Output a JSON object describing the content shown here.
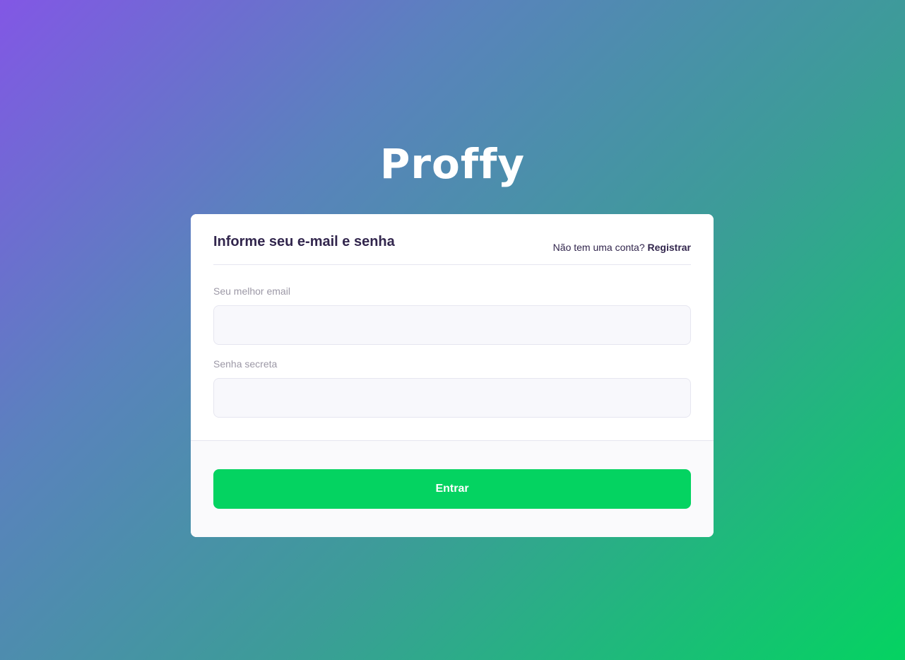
{
  "brand": {
    "logo_text": "Proffy"
  },
  "login_card": {
    "title": "Informe seu e-mail e senha",
    "signup_prompt": "Não tem uma conta?",
    "signup_link": "Registrar",
    "email_label": "Seu melhor email",
    "email_value": "",
    "password_label": "Senha secreta",
    "password_value": "",
    "submit_label": "Entrar"
  },
  "colors": {
    "gradient_start": "#8257E5",
    "gradient_end": "#04D361",
    "button": "#04D361",
    "title_text": "#32264D",
    "label_text": "#9C98A6"
  }
}
